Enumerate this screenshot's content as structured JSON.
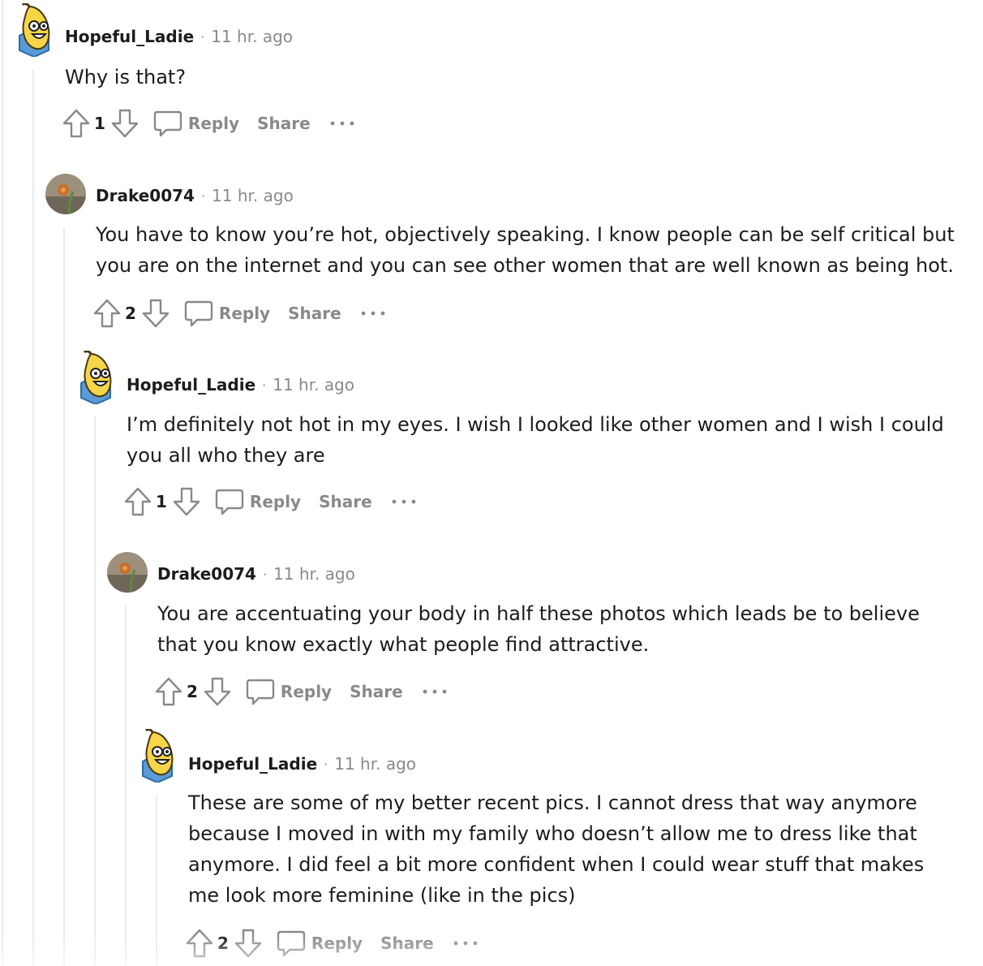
{
  "comments": [
    {
      "username": "Hopeful_Ladie",
      "time": "11 hr. ago",
      "avatar": "banana-avatar",
      "body": "Why is that?",
      "score": "1",
      "reply_label": "Reply",
      "share_label": "Share"
    },
    {
      "username": "Drake0074",
      "time": "11 hr. ago",
      "avatar": "flower-photo-avatar",
      "body": "You have to know you’re hot, objectively speaking. I know people can be self critical but you are on the internet and you can see other women that are well known as being hot.",
      "score": "2",
      "reply_label": "Reply",
      "share_label": "Share"
    },
    {
      "username": "Hopeful_Ladie",
      "time": "11 hr. ago",
      "avatar": "banana-avatar",
      "body": "I’m definitely not hot in my eyes. I wish I looked like other women and I wish I could you all who they are",
      "score": "1",
      "reply_label": "Reply",
      "share_label": "Share"
    },
    {
      "username": "Drake0074",
      "time": "11 hr. ago",
      "avatar": "flower-photo-avatar",
      "body": "You are accentuating your body in half these photos which leads be to believe that you know exactly what people find attractive.",
      "score": "2",
      "reply_label": "Reply",
      "share_label": "Share"
    },
    {
      "username": "Hopeful_Ladie",
      "time": "11 hr. ago",
      "avatar": "banana-avatar",
      "body": "These are some of my better recent pics. I cannot dress that way anymore because I moved in with my family who doesn’t allow me to dress like that anymore. I did feel a bit more confident when I could wear stuff that makes me look more feminine (like in the pics)",
      "score": "2",
      "reply_label": "Reply",
      "share_label": "Share"
    }
  ],
  "separator": "·",
  "colors": {
    "meta_gray": "#878a8c",
    "thread_line": "#e9eaeb",
    "text": "#1c1c1c"
  },
  "icons": [
    "upvote-icon",
    "downvote-icon",
    "comment-bubble-icon",
    "more-options-icon"
  ]
}
